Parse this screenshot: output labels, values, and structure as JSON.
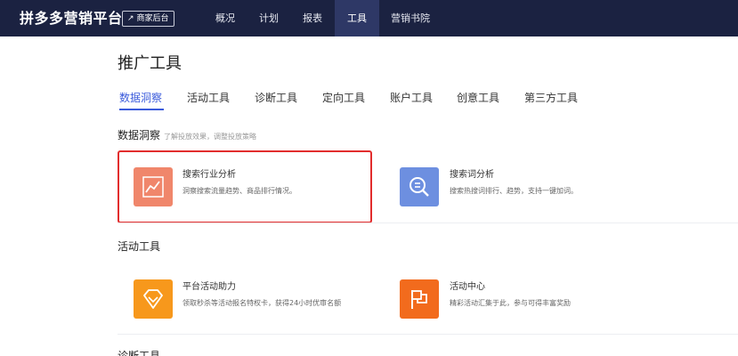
{
  "header": {
    "logo": "拼多多营销平台",
    "merchant_button": "商家后台",
    "nav": [
      {
        "label": "概况",
        "active": false
      },
      {
        "label": "计划",
        "active": false
      },
      {
        "label": "报表",
        "active": false
      },
      {
        "label": "工具",
        "active": true
      },
      {
        "label": "营销书院",
        "active": false
      }
    ]
  },
  "page_title": "推广工具",
  "tabs": [
    {
      "label": "数据洞察",
      "active": true
    },
    {
      "label": "活动工具",
      "active": false
    },
    {
      "label": "诊断工具",
      "active": false
    },
    {
      "label": "定向工具",
      "active": false
    },
    {
      "label": "账户工具",
      "active": false
    },
    {
      "label": "创意工具",
      "active": false
    },
    {
      "label": "第三方工具",
      "active": false
    }
  ],
  "sections": [
    {
      "title": "数据洞察",
      "subtitle": "了解投放效果，调整投放策略",
      "cards": [
        {
          "name": "搜索行业分析",
          "desc": "洞察搜索流量趋势、商品排行情况。",
          "icon": "line-chart-icon",
          "color": "#f0866b"
        },
        {
          "name": "搜索词分析",
          "desc": "搜索热搜词排行、趋势，支持一键加词。",
          "icon": "search-list-icon",
          "color": "#6d8fe0"
        }
      ]
    },
    {
      "title": "活动工具",
      "subtitle": "",
      "cards": [
        {
          "name": "平台活动助力",
          "desc": "领取秒杀等活动报名特权卡，获得24小时优审名额",
          "icon": "diamond-icon",
          "color": "#f7981c"
        },
        {
          "name": "活动中心",
          "desc": "精彩活动汇集于此，参与可得丰富奖励",
          "icon": "flag-icon",
          "color": "#f26b1d"
        }
      ]
    },
    {
      "title": "诊断工具",
      "subtitle": "",
      "cards": []
    }
  ],
  "colors": {
    "topbar": "#1b2241",
    "nav_active": "#2e3866",
    "accent": "#3b5bdb",
    "highlight": "#e22d2d"
  }
}
